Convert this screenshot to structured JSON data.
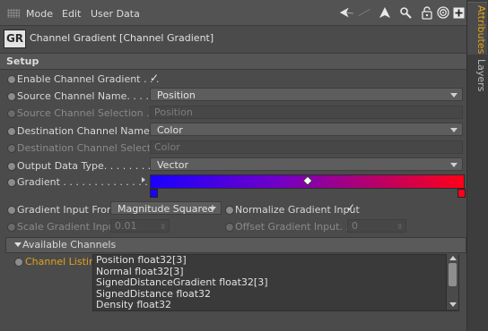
{
  "menu": {
    "grip_icon": "grip-icon",
    "items": [
      "Mode",
      "Edit",
      "User Data"
    ],
    "toolbar_icons": [
      "arrow-left-icon",
      "arrow-up-icon",
      "magnifier-icon",
      "lock-icon",
      "target-icon",
      "add-panel-icon"
    ]
  },
  "object": {
    "logo": "GR",
    "title": "Channel Gradient [Channel Gradient]"
  },
  "setup": {
    "title": "Setup",
    "enable_label": "Enable Channel Gradient . . .",
    "enable_checked": true,
    "source_label": "Source Channel Name. . . . . .",
    "source_value": "Position",
    "source_sel_label": "Source Channel Selection . . .",
    "source_sel_placeholder": "Position",
    "dest_label": "Destination Channel Name . .",
    "dest_value": "Color",
    "dest_sel_label": "Destination Channel Selection",
    "dest_sel_placeholder": "Color",
    "output_label": "Output Data Type. . . . . . . . . .",
    "output_value": "Vector",
    "gradient_label": "Gradient . . . . . . . . . . . . . . . .",
    "gradient_input_label": "Gradient Input From",
    "gradient_input_value": "Magnitude Squared",
    "normalize_label": "Normalize Gradient Input",
    "normalize_checked": true,
    "scale_label": "Scale Gradient Input",
    "scale_value": "0.01",
    "offset_label": "Offset Gradient Input. . .",
    "offset_value": "0"
  },
  "channels": {
    "title": "Available Channels",
    "listing_label": "Channel Listing",
    "items": [
      "Position float32[3]",
      "Normal float32[3]",
      "SignedDistanceGradient float32[3]",
      "SignedDistance float32",
      "Density float32"
    ]
  },
  "side_tabs": [
    "Attributes",
    "Layers"
  ],
  "colors": {
    "gradient_start": "#1a00ff",
    "gradient_end": "#ff0018",
    "active_tab": "#e3a21a",
    "listing_label": "#e3a21a"
  }
}
